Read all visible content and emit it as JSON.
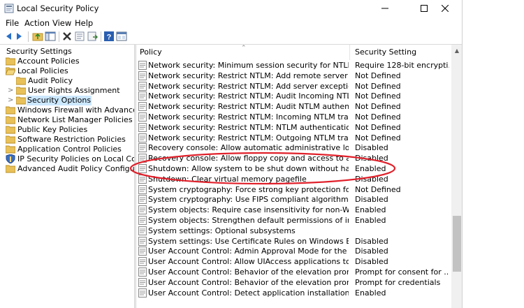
{
  "window": {
    "title": "Local Security Policy",
    "controls": {
      "minimize": "minimize-icon",
      "maximize": "maximize-icon",
      "close": "close-icon"
    }
  },
  "menu": [
    "File",
    "Action",
    "View",
    "Help"
  ],
  "toolbar": [
    "back-icon",
    "forward-icon",
    "up-folder-icon",
    "show-tree-icon",
    "delete-icon",
    "properties-icon",
    "export-icon",
    "help-icon",
    "console-icon"
  ],
  "tree": {
    "root": "Security Settings",
    "items": [
      {
        "label": "Account Policies",
        "level": 1,
        "expander": "",
        "icon": "folder"
      },
      {
        "label": "Local Policies",
        "level": 1,
        "expander": "",
        "icon": "folder-open"
      },
      {
        "label": "Audit Policy",
        "level": 2,
        "expander": "",
        "icon": "folder"
      },
      {
        "label": "User Rights Assignment",
        "level": 2,
        "expander": ">",
        "icon": "folder"
      },
      {
        "label": "Security Options",
        "level": 2,
        "expander": ">",
        "icon": "folder",
        "selected": true
      },
      {
        "label": "Windows Firewall with Advanced Securit",
        "level": 1,
        "expander": "",
        "icon": "folder"
      },
      {
        "label": "Network List Manager Policies",
        "level": 1,
        "expander": "",
        "icon": "folder"
      },
      {
        "label": "Public Key Policies",
        "level": 1,
        "expander": "",
        "icon": "folder"
      },
      {
        "label": "Software Restriction Policies",
        "level": 1,
        "expander": "",
        "icon": "folder"
      },
      {
        "label": "Application Control Policies",
        "level": 1,
        "expander": "",
        "icon": "folder"
      },
      {
        "label": "IP Security Policies on Local Computer",
        "level": 1,
        "expander": "",
        "icon": "shield"
      },
      {
        "label": "Advanced Audit Policy Configuration",
        "level": 1,
        "expander": "",
        "icon": "folder"
      }
    ]
  },
  "list": {
    "columns": [
      "Policy",
      "Security Setting"
    ],
    "rows": [
      [
        "Network security: Minimum session security for NTLM SSP based (in...",
        "Require 128-bit encrypti..."
      ],
      [
        "Network security: Restrict NTLM: Add remote server exceptions for ...",
        "Not Defined"
      ],
      [
        "Network security: Restrict NTLM: Add server exceptions in this domain",
        "Not Defined"
      ],
      [
        "Network security: Restrict NTLM: Audit Incoming NTLM Traffic",
        "Not Defined"
      ],
      [
        "Network security: Restrict NTLM: Audit NTLM authentication in this ...",
        "Not Defined"
      ],
      [
        "Network security: Restrict NTLM: Incoming NTLM traffic",
        "Not Defined"
      ],
      [
        "Network security: Restrict NTLM: NTLM authentication in this domain",
        "Not Defined"
      ],
      [
        "Network security: Restrict NTLM: Outgoing NTLM traffic to remote se...",
        "Not Defined"
      ],
      [
        "Recovery console: Allow automatic administrative logon",
        "Disabled"
      ],
      [
        "Recovery console: Allow floppy copy and access to all drives and all ...",
        "Disabled"
      ],
      [
        "Shutdown: Allow system to be shut down without having to log on",
        "Enabled"
      ],
      [
        "Shutdown: Clear virtual memory pagefile",
        "Disabled"
      ],
      [
        "System cryptography: Force strong key protection for user keys store...",
        "Not Defined"
      ],
      [
        "System cryptography: Use FIPS compliant algorithms for encryption,...",
        "Disabled"
      ],
      [
        "System objects: Require case insensitivity for non-Windows subsyste...",
        "Enabled"
      ],
      [
        "System objects: Strengthen default permissions of internal system o...",
        "Enabled"
      ],
      [
        "System settings: Optional subsystems",
        ""
      ],
      [
        "System settings: Use Certificate Rules on Windows Executables for S...",
        "Disabled"
      ],
      [
        "User Account Control: Admin Approval Mode for the Built-in Admin...",
        "Disabled"
      ],
      [
        "User Account Control: Allow UIAccess applications to prompt for ele...",
        "Disabled"
      ],
      [
        "User Account Control: Behavior of the elevation prompt for administ...",
        "Prompt for consent for ..."
      ],
      [
        "User Account Control: Behavior of the elevation prompt for standard...",
        "Prompt for credentials"
      ],
      [
        "User Account Control: Detect application installations and prompt f...",
        "Enabled"
      ]
    ]
  },
  "annotation": {
    "color": "#e0202a",
    "highlights": "Shutdown: Allow system to be shut down without having to log on"
  }
}
